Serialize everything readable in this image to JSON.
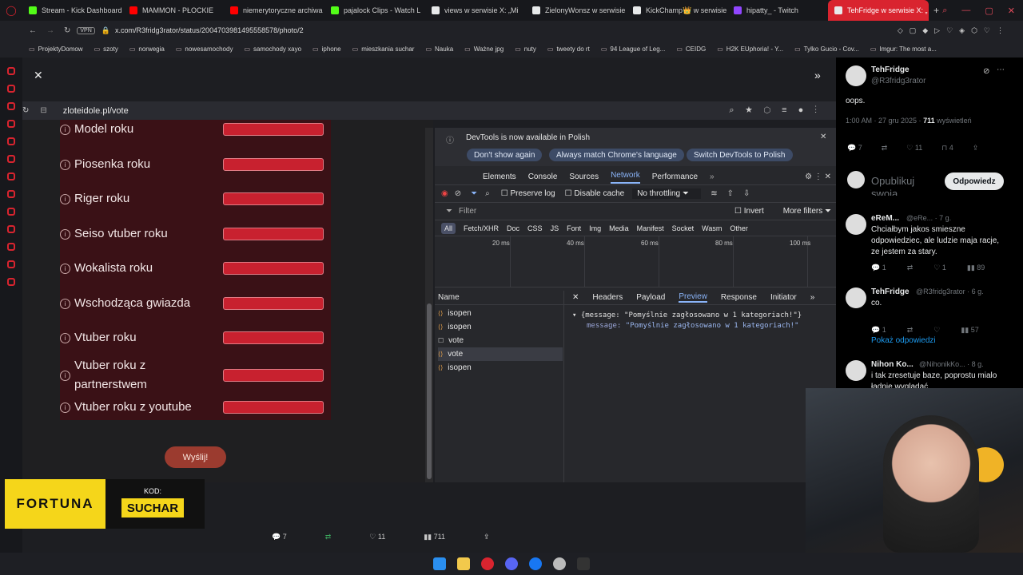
{
  "browser": {
    "tabs": [
      {
        "label": "Stream - Kick Dashboard",
        "color": "#53fc18"
      },
      {
        "label": "MAMMON - PŁOCKIE",
        "color": "#ff0000"
      },
      {
        "label": "niemerytoryczne archiwa",
        "color": "#ff0000"
      },
      {
        "label": "pajalock Clips - Watch L",
        "color": "#53fc18"
      },
      {
        "label": "views w serwisie X: „Mi",
        "color": "#e7e9ea"
      },
      {
        "label": "ZielonyWonsz w serwisie",
        "color": "#e7e9ea"
      },
      {
        "label": "KickChamp👑 w serwisie",
        "color": "#e7e9ea"
      },
      {
        "label": "hipatty_ - Twitch",
        "color": "#9146ff"
      },
      {
        "label": "TehFridge w serwisie X: „",
        "color": "#e7e9ea"
      }
    ],
    "vpn": "VPN",
    "url": "x.com/R3fridg3rator/status/2004703981495558578/photo/2",
    "bookmarks": [
      "ProjektyDomow",
      "szoty",
      "norwegia",
      "nowesamochody",
      "samochody xayo",
      "iphone",
      "mieszkania suchar",
      "Nauka",
      "Ważne jpg",
      "nuty",
      "tweety do rt",
      "94 League of Leg...",
      "CEIDG",
      "H2K EUphoria! - Y...",
      "Tylko Gucio - Cov...",
      "Imgur: The most a..."
    ]
  },
  "inner": {
    "url": "zloteidole.pl/vote",
    "categories": [
      "Model roku",
      "Piosenka roku",
      "Riger roku",
      "Seiso vtuber roku",
      "Wokalista roku",
      "Wschodząca gwiazda",
      "Vtuber roku",
      "Vtuber roku z partnerstwem",
      "Vtuber roku z youtube"
    ],
    "send_label": "Wyślij!"
  },
  "devtools": {
    "info": "DevTools is now available in Polish",
    "btn_dont_show": "Don't show again",
    "btn_match": "Always match Chrome's language",
    "btn_switch": "Switch DevTools to Polish",
    "tabs": [
      "Elements",
      "Console",
      "Sources",
      "Network",
      "Performance"
    ],
    "preserve_log": "Preserve log",
    "disable_cache": "Disable cache",
    "throttling": "No throttling",
    "filter_placeholder": "Filter",
    "invert": "Invert",
    "more_filters": "More filters",
    "types": [
      "All",
      "Fetch/XHR",
      "Doc",
      "CSS",
      "JS",
      "Font",
      "Img",
      "Media",
      "Manifest",
      "Socket",
      "Wasm",
      "Other"
    ],
    "ticks": [
      "20 ms",
      "40 ms",
      "60 ms",
      "80 ms",
      "100 ms"
    ],
    "name_header": "Name",
    "requests": [
      "isopen",
      "isopen",
      "vote",
      "vote",
      "isopen"
    ],
    "detail_tabs": [
      "Headers",
      "Payload",
      "Preview",
      "Response",
      "Initiator"
    ],
    "json_line1": "{message: \"Pomyślnie zagłosowano w 1 kategoriach!\"}",
    "json_key": "message:",
    "json_value": "\"Pomyślnie zagłosowano w 1 kategoriach!\""
  },
  "viewer_actions": {
    "replies": "7",
    "reposts": "",
    "likes": "11",
    "views": "711"
  },
  "twitter": {
    "author": "TehFridge",
    "handle": "@R3fridg3rator",
    "text": "oops.",
    "time": "1:00 AM · 27 gru 2025 ·",
    "views_count": "711",
    "views_label": "wyświetleń",
    "stats": [
      "7",
      "",
      "11",
      "4"
    ],
    "reply_placeholder": "Opublikuj swoją odpowiedź",
    "reply_button": "Odpowiedz",
    "replies": [
      {
        "name": "eReM...",
        "meta": "@eRe... · 7 g.",
        "text": "Chciałbym jakos smieszne odpowiedziec, ale ludzie maja racje, ze jestem za stary.",
        "stats": [
          "1",
          "",
          "1",
          "89"
        ]
      },
      {
        "name": "TehFridge",
        "meta": "@R3fridg3rator · 6 g.",
        "text": "co.",
        "stats": [
          "1",
          "",
          "",
          "57"
        ]
      },
      {
        "name": "Nihon Ko...",
        "meta": "@NihonikKo... · 8 g.",
        "text": "i tak zresetuje baze, poprostu mialo ładnie wygladać",
        "stats": []
      }
    ],
    "show_replies": "Pokaż odpowiedzi"
  },
  "ad": {
    "brand": "FORTUNA",
    "code_label": "KOD:",
    "code": "SUCHAR"
  }
}
